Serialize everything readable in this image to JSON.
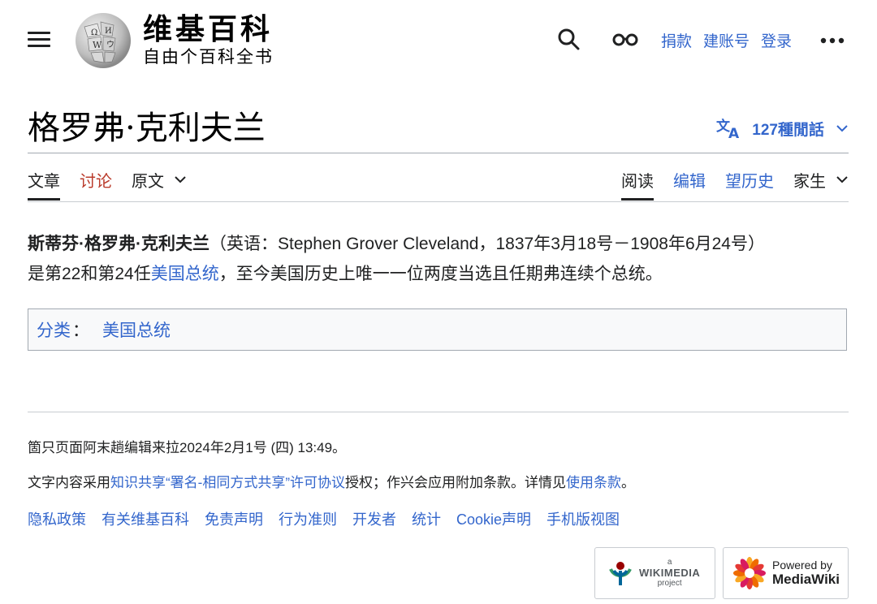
{
  "header": {
    "logo_title": "维基百科",
    "logo_tagline": "自由个百科全书",
    "links": [
      {
        "label": "捐款"
      },
      {
        "label": "建账号"
      },
      {
        "label": "登录"
      }
    ],
    "icons": [
      "menu-icon",
      "search-icon",
      "watchlist-icon",
      "more-icon"
    ]
  },
  "title": {
    "text": "格罗弗·克利夫兰",
    "languages_label": "127種閒話"
  },
  "tabs": {
    "left": [
      {
        "label": "文章",
        "state": "active"
      },
      {
        "label": "讨论",
        "state": "new"
      },
      {
        "label": "原文",
        "state": "dropdown"
      }
    ],
    "right": [
      {
        "label": "阅读",
        "state": "active"
      },
      {
        "label": "编辑"
      },
      {
        "label": "望历史"
      },
      {
        "label": "家生",
        "state": "dropdown"
      }
    ]
  },
  "content": {
    "subject_bold": "斯蒂芬·格罗弗·克利夫兰",
    "lead_1": "（英语：Stephen Grover Cleveland，1837年3月18号－1908年6月24号）",
    "lead_2": "是第22和第24任",
    "link_president": "美国总统",
    "lead_3": "，至今美国历史上唯一一位两度当选且任期弗连续个总统。"
  },
  "categories": {
    "label": "分类",
    "separator": "：",
    "items": [
      "美国总统"
    ]
  },
  "footer": {
    "last_edited": "箇只页面阿末趟编辑来拉2024年2月1号 (四) 13:49。",
    "license_prefix": "文字内容采用",
    "license_link": "知识共享“署名-相同方式共享”许可协议",
    "license_mid": "授权；作兴会应用附加条款。详情见",
    "terms_link": "使用条款",
    "license_suffix": "。",
    "links": [
      "隐私政策",
      "有关维基百科",
      "免责声明",
      "行为准则",
      "开发者",
      "统计",
      "Cookie声明",
      "手机版视图"
    ],
    "badge_wikimedia": {
      "small": "a",
      "big": "WIKIMEDIA",
      "sub": "project"
    },
    "badge_mediawiki": {
      "small": "Powered by",
      "big": "MediaWiki"
    }
  },
  "colors": {
    "link": "#3366cc",
    "new_link": "#ba3b2b",
    "text": "#202122",
    "border": "#a2a9b1"
  }
}
